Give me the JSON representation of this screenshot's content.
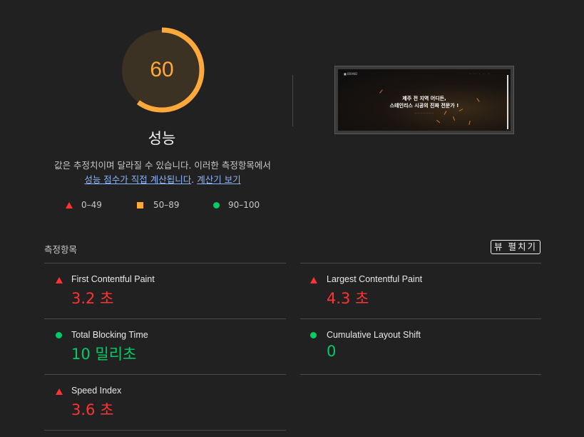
{
  "score": {
    "value": "60",
    "fraction": 0.6,
    "title": "성능",
    "color": "#ffa83c"
  },
  "description": {
    "text": "값은 추정치이며 달라질 수 있습니다. 이러한 측정항목에서",
    "link1": "성능 점수가 직접 계산됩니다",
    "separator": ".",
    "link2": "계산기 보기"
  },
  "legend": [
    {
      "icon": "triangle-icon",
      "label": "0–49",
      "color": "#ff3333"
    },
    {
      "icon": "square-icon",
      "label": "50–89",
      "color": "#ffa83c"
    },
    {
      "icon": "circle-icon",
      "label": "90–100",
      "color": "#00cc66"
    }
  ],
  "screenshot": {
    "brand": "■ BRAND",
    "nav": "· · · · ·",
    "headline_line1": "제주 전 지역 어디든,",
    "headline_line2": "스테인리스 시공의 진짜 전문가 !",
    "subtext": "— — — — — — —"
  },
  "metrics_section": {
    "label": "측정항목",
    "expand_button": "뷰 펼치기"
  },
  "metrics": [
    {
      "name": "First Contentful Paint",
      "value": "3.2 초",
      "status": "poor",
      "icon": "triangle-icon"
    },
    {
      "name": "Largest Contentful Paint",
      "value": "4.3 초",
      "status": "poor",
      "icon": "triangle-icon"
    },
    {
      "name": "Total Blocking Time",
      "value": "10 밀리초",
      "status": "good",
      "icon": "circle-icon"
    },
    {
      "name": "Cumulative Layout Shift",
      "value": "0",
      "status": "good",
      "icon": "circle-icon"
    },
    {
      "name": "Speed Index",
      "value": "3.6 초",
      "status": "poor",
      "icon": "triangle-icon"
    }
  ],
  "colors": {
    "background": "#212121",
    "poor": "#ff3333",
    "average": "#ffa83c",
    "good": "#00cc66",
    "link": "#8ab4f8"
  }
}
